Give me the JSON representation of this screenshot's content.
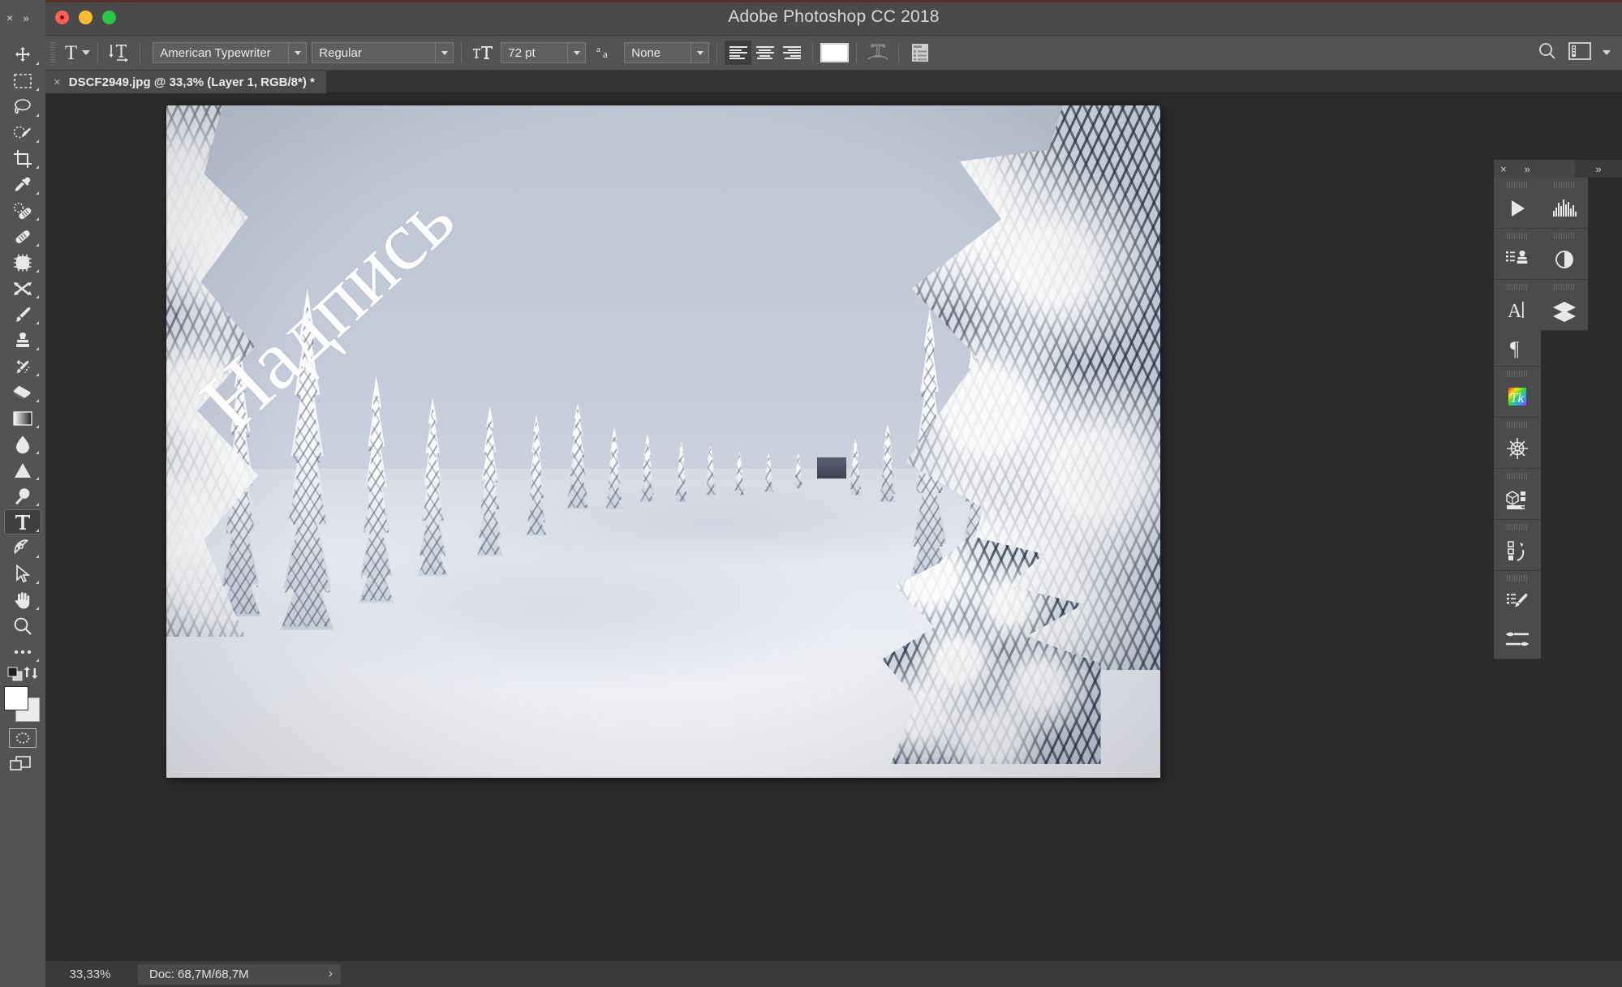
{
  "window": {
    "title": "Adobe Photoshop CC 2018",
    "traffic_lights": [
      "close",
      "minimize",
      "zoom"
    ]
  },
  "toolbar_panel": {
    "collapse_label": "×",
    "expand_label": "»"
  },
  "options_bar": {
    "tool_preset_label": "T",
    "tool_preset_caret": "⌄",
    "orientation_icon": "text-orientation-icon",
    "font_family": "American Typewriter",
    "font_style": "Regular",
    "font_size": "72 pt",
    "anti_alias_icon": "aa-icon",
    "anti_alias": "None",
    "align": [
      "left",
      "center",
      "right"
    ],
    "align_selected": "left",
    "text_color": "#ffffff",
    "warp_label": "warp-text-icon",
    "panel_toggle_label": "character-paragraph-panels-icon",
    "search_icon": "search-icon",
    "workspace_icon": "workspace-icon",
    "workspace_caret": "⌄"
  },
  "tools": [
    {
      "name": "move-tool",
      "selected": false
    },
    {
      "name": "rectangular-marquee-tool",
      "selected": false
    },
    {
      "name": "lasso-tool",
      "selected": false
    },
    {
      "name": "quick-selection-tool",
      "selected": false
    },
    {
      "name": "crop-tool",
      "selected": false
    },
    {
      "name": "eyedropper-tool",
      "selected": false
    },
    {
      "name": "spot-healing-brush-tool",
      "selected": false
    },
    {
      "name": "healing-brush-tool",
      "selected": false
    },
    {
      "name": "patch-tool",
      "selected": false
    },
    {
      "name": "content-aware-move-tool",
      "selected": false
    },
    {
      "name": "brush-tool",
      "selected": false
    },
    {
      "name": "clone-stamp-tool",
      "selected": false
    },
    {
      "name": "history-brush-tool",
      "selected": false
    },
    {
      "name": "eraser-tool",
      "selected": false
    },
    {
      "name": "gradient-tool",
      "selected": false
    },
    {
      "name": "blur-tool",
      "selected": false
    },
    {
      "name": "dodge-tool",
      "selected": false
    },
    {
      "name": "burn-tool",
      "selected": false
    },
    {
      "name": "type-tool",
      "selected": true
    },
    {
      "name": "pen-tool",
      "selected": false
    },
    {
      "name": "path-selection-tool",
      "selected": false
    },
    {
      "name": "hand-tool",
      "selected": false
    },
    {
      "name": "zoom-tool",
      "selected": false
    },
    {
      "name": "edit-toolbar-tool",
      "selected": false
    }
  ],
  "color_controls": {
    "foreground": "#ffffff",
    "background": "#ececec",
    "default_colors_icon": "default-colors-icon",
    "swap_colors_icon": "swap-colors-icon",
    "quick_mask_icon": "quick-mask-icon",
    "screen_mode_icon": "screen-mode-icon"
  },
  "document": {
    "tab_close": "×",
    "tab_title": "DSCF2949.jpg @ 33,3% (Layer 1, RGB/8*) *",
    "filename": "DSCF2949.jpg",
    "zoom": "33,3%",
    "layer": "Layer 1",
    "mode": "RGB/8*",
    "modified": true
  },
  "canvas": {
    "overlay_text": "Надпись",
    "overlay_color": "#ffffff",
    "overlay_rotation_deg": -43,
    "scene_description": "snow-covered-pine-forest-path"
  },
  "panels": {
    "close_icon": "×",
    "expand_icon": "»",
    "expand_icon_2": "»",
    "column_a": [
      {
        "name": "actions-panel-icon"
      },
      {
        "name": "histogram-panel-icon"
      },
      {
        "name": "adjustments-panel-icon"
      },
      {
        "name": "properties-panel-icon"
      },
      {
        "name": "character-panel-icon"
      },
      {
        "name": "paragraph-panel-icon"
      },
      {
        "name": "layers-panel-icon"
      },
      {
        "name": "kuler-panel-icon"
      },
      {
        "name": "navigator-panel-icon"
      },
      {
        "name": "3d-panel-icon"
      },
      {
        "name": "history-panel-icon"
      },
      {
        "name": "brush-presets-panel-icon"
      },
      {
        "name": "brush-settings-panel-icon"
      }
    ]
  },
  "status_bar": {
    "zoom": "33,33%",
    "doc_info": "Doc: 68,7M/68,7M",
    "expand_chevron": "›"
  }
}
